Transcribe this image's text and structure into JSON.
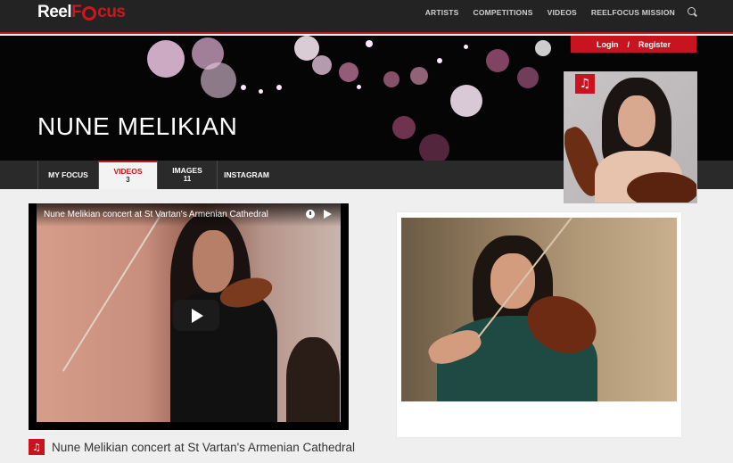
{
  "site": {
    "logo_left": "Reel",
    "logo_right": "cus"
  },
  "nav": {
    "items": [
      "ARTISTS",
      "COMPETITIONS",
      "VIDEOS",
      "REELFOCUS MISSION"
    ]
  },
  "auth": {
    "login": "Login",
    "separator": "/",
    "register": "Register"
  },
  "artist": {
    "name": "NUNE MELIKIAN"
  },
  "tabs": [
    {
      "label": "MY FOCUS",
      "count": ""
    },
    {
      "label": "VIDEOS",
      "count": "3"
    },
    {
      "label": "IMAGES",
      "count": "11"
    },
    {
      "label": "INSTAGRAM",
      "count": ""
    }
  ],
  "video": {
    "title": "Nune Melikian concert at St Vartan's Armenian Cathedral",
    "caption": "Nune Melikian concert at St Vartan's Armenian Cathedral"
  },
  "icons": {
    "music_note": "♫"
  },
  "colors": {
    "accent": "#c8141e",
    "topbar": "#232323"
  }
}
